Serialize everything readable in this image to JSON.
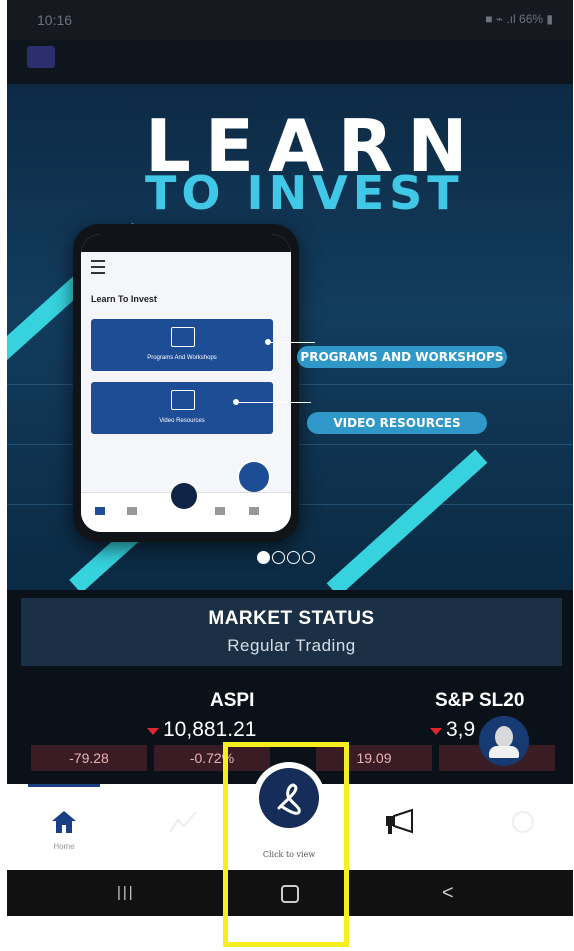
{
  "status_bar": {
    "time": "10:16",
    "indicators": "■ ⌁ .ıl 66% ▮"
  },
  "banner": {
    "headline": "LEARN",
    "subheadline": "TO INVEST",
    "mock_title": "Learn To Invest",
    "mock_card1": "Programs And Workshops",
    "mock_card2": "Video Resources",
    "callout1": "PROGRAMS AND WORKSHOPS",
    "callout2": "VIDEO RESOURCES",
    "carousel": {
      "count": 4,
      "active": 0
    }
  },
  "market": {
    "heading": "MARKET STATUS",
    "status": "Regular Trading"
  },
  "indices": [
    {
      "name": "ASPI",
      "value": "10,881.21",
      "change": "-79.28",
      "change_pct": "-0.72%"
    },
    {
      "name": "S&P SL20",
      "value": "3,9  .19",
      "change": "19.09",
      "change_pct": "-0.  "
    }
  ],
  "bottom_nav": {
    "home_label": "Home",
    "center_label": "Click to view",
    "icons": [
      "home-icon",
      "market-icon",
      "services-icon",
      "announcement-icon",
      "notification-icon"
    ]
  },
  "colors": {
    "accent": "#1b3f82",
    "negative": "#e0262e",
    "highlight": "#f5ee20",
    "banner_cyan": "#36d3de"
  }
}
